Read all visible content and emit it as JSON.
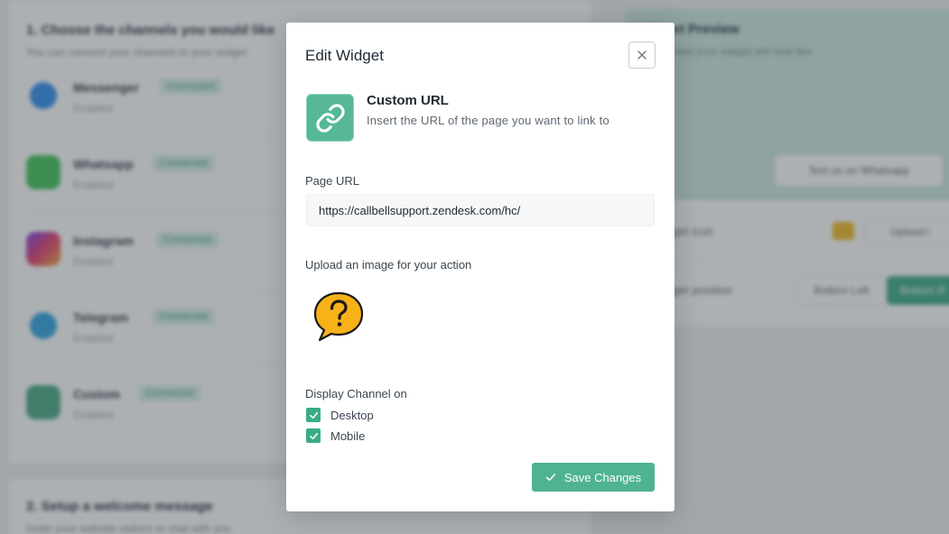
{
  "background": {
    "section1_title": "1. Choose the channels you would like",
    "section1_sub": "You can connect your channels to your widget",
    "channels": [
      {
        "name": "Messenger",
        "badge": "Connected",
        "state": "Enabled",
        "color": "#2d8cf0"
      },
      {
        "name": "Whatsapp",
        "badge": "Connected",
        "state": "Enabled",
        "color": "#3fc35a"
      },
      {
        "name": "Instagram",
        "badge": "Connected",
        "state": "Enabled",
        "color": "#d6388a"
      },
      {
        "name": "Telegram",
        "badge": "Connected",
        "state": "Enabled",
        "color": "#2aa3e0"
      },
      {
        "name": "Custom",
        "badge": "Connected",
        "state": "Enabled",
        "color": "#46a883"
      }
    ],
    "section2_title": "2. Setup a welcome message",
    "section2_sub": "Invite your website visitors to chat with you",
    "preview_title": "Widget Preview",
    "preview_sub": "This is how your widget will look like",
    "whatsapp_button": "Text us on Whatsapp",
    "icon_label": "Widget icon",
    "upload_label": "Upload i",
    "position_label": "Widget position",
    "bottom_left": "Bottom Left",
    "bottom_right": "Bottom R"
  },
  "modal": {
    "title": "Edit Widget",
    "action_title": "Custom URL",
    "action_description": "Insert the URL of the page you want to link to",
    "page_url_label": "Page URL",
    "page_url_value": "https://callbellsupport.zendesk.com/hc/",
    "upload_label": "Upload an image for your action",
    "display_label": "Display Channel on",
    "options": [
      {
        "label": "Desktop",
        "checked": true
      },
      {
        "label": "Mobile",
        "checked": true
      }
    ],
    "save_label": "Save Changes"
  },
  "colors": {
    "accent": "#4fb393",
    "checkbox": "#3aab85",
    "tile": "#56b897",
    "overlay": "rgba(60,66,74,0.42)"
  },
  "icons": [
    "close-icon",
    "link-icon",
    "question-bubble-icon",
    "check-icon"
  ]
}
